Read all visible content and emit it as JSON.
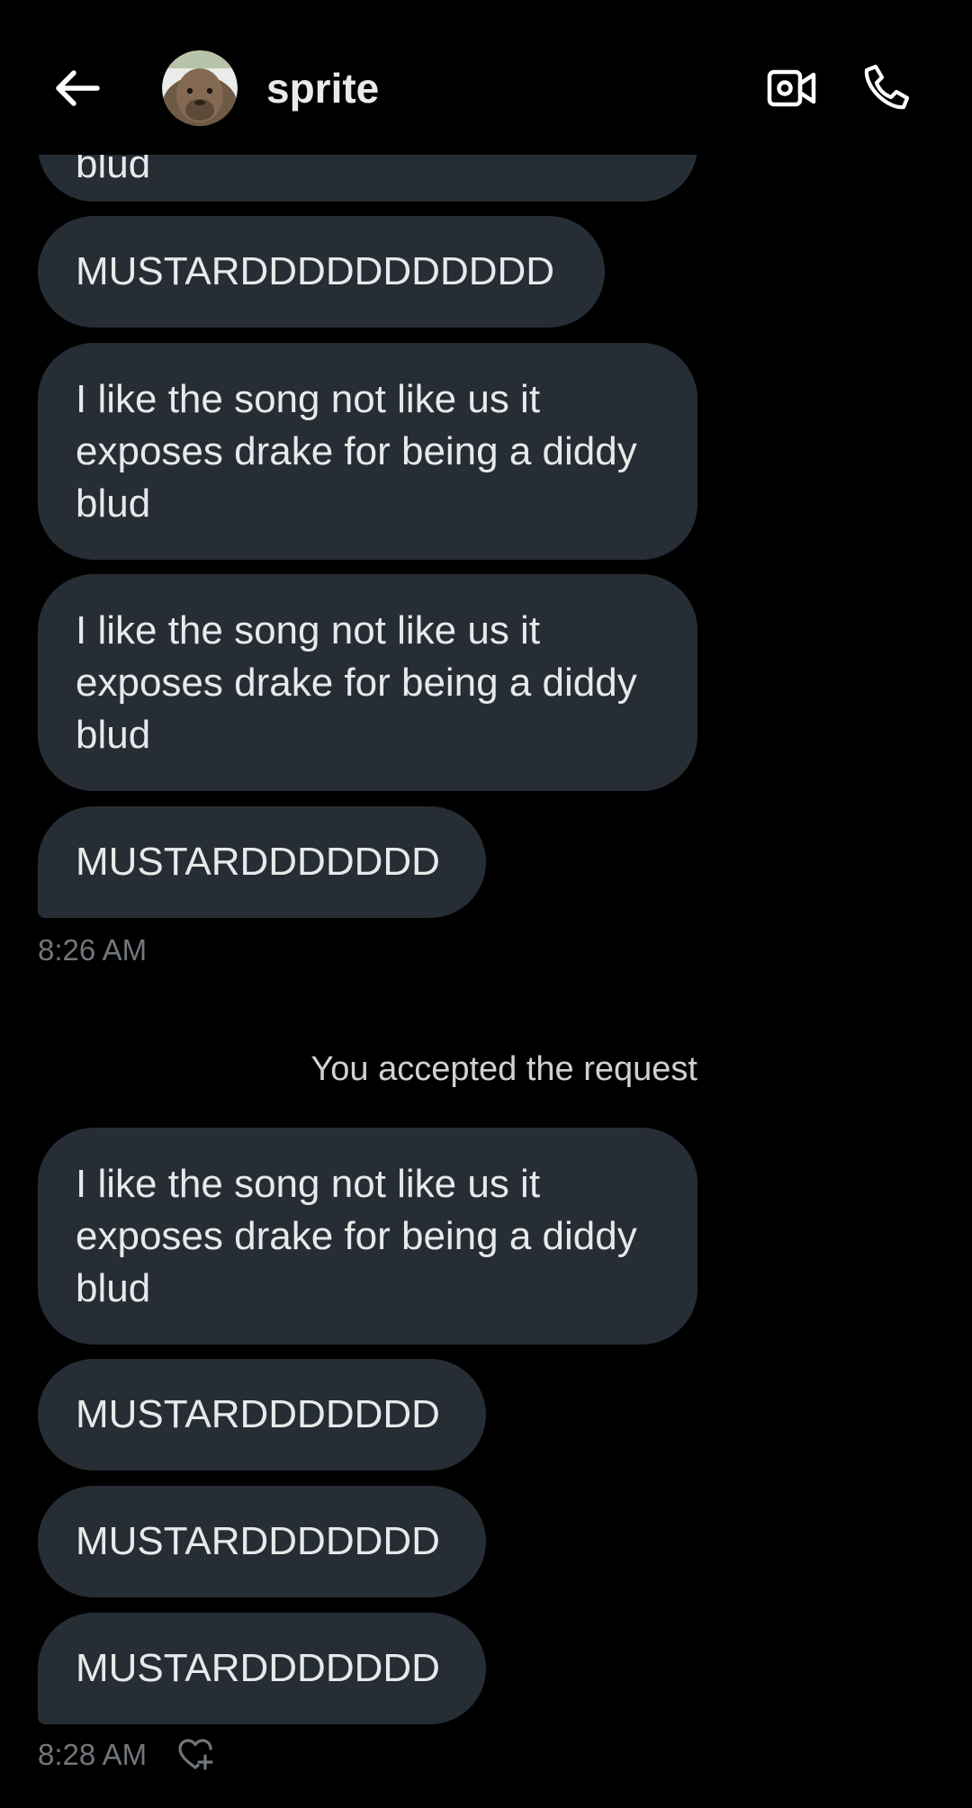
{
  "header": {
    "contact_name": "sprite"
  },
  "messages": [
    {
      "text": "blud"
    },
    {
      "text": "MUSTARDDDDDDDDDDD"
    },
    {
      "text": "I like the song not like us it exposes drake for being a diddy blud"
    },
    {
      "text": "I like the song not like us it exposes drake for being a diddy blud"
    },
    {
      "text": "MUSTARDDDDDDD"
    },
    {
      "text": "I like the song not like us it exposes drake for being a diddy blud"
    },
    {
      "text": "MUSTARDDDDDDD"
    },
    {
      "text": "MUSTARDDDDDDD"
    },
    {
      "text": "MUSTARDDDDDDD"
    }
  ],
  "timestamps": {
    "first": "8:26 AM",
    "second": "8:28 AM"
  },
  "system": {
    "accepted": "You accepted the request"
  },
  "colors": {
    "background": "#000000",
    "bubble": "#262d34",
    "text": "#e7e9ea",
    "muted": "#71767b"
  }
}
